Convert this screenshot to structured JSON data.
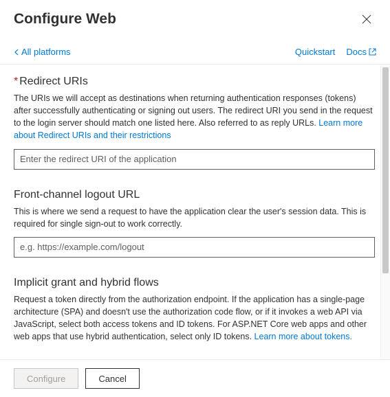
{
  "header": {
    "title": "Configure Web"
  },
  "subheader": {
    "back_label": "All platforms",
    "quickstart_label": "Quickstart",
    "docs_label": "Docs"
  },
  "sections": {
    "redirect": {
      "title": "Redirect URIs",
      "desc": "The URIs we will accept as destinations when returning authentication responses (tokens) after successfully authenticating or signing out users. The redirect URI you send in the request to the login server should match one listed here. Also referred to as reply URLs. ",
      "link": "Learn more about Redirect URIs and their restrictions",
      "placeholder": "Enter the redirect URI of the application"
    },
    "logout": {
      "title": "Front-channel logout URL",
      "desc": "This is where we send a request to have the application clear the user's session data. This is required for single sign-out to work correctly.",
      "placeholder": "e.g. https://example.com/logout"
    },
    "implicit": {
      "title": "Implicit grant and hybrid flows",
      "desc": "Request a token directly from the authorization endpoint. If the application has a single-page architecture (SPA) and doesn't use the authorization code flow, or if it invokes a web API via JavaScript, select both access tokens and ID tokens. For ASP.NET Core web apps and other web apps that use hybrid authentication, select only ID tokens. ",
      "link": "Learn more about tokens."
    }
  },
  "footer": {
    "configure_label": "Configure",
    "cancel_label": "Cancel"
  }
}
